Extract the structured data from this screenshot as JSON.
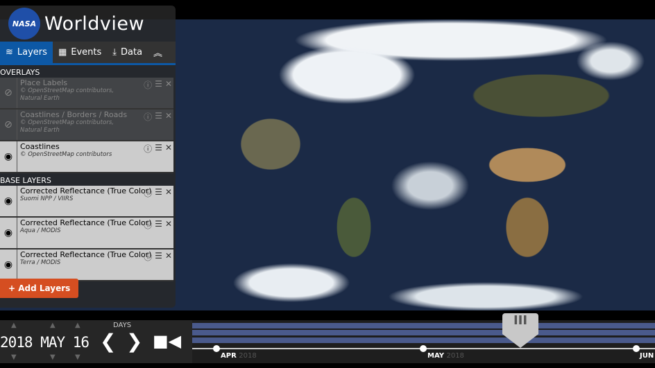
{
  "app": {
    "title": "Worldview",
    "logo": "NASA"
  },
  "tabs": [
    {
      "label": "Layers",
      "icon": "layers-icon"
    },
    {
      "label": "Events",
      "icon": "calendar-icon"
    },
    {
      "label": "Data",
      "icon": "download-icon"
    }
  ],
  "overlays": {
    "title": "OVERLAYS",
    "items": [
      {
        "name": "Place Labels",
        "sub1": "© OpenStreetMap contributors,",
        "sub2": "Natural Earth",
        "visible": false
      },
      {
        "name": "Coastlines / Borders / Roads",
        "sub1": "© OpenStreetMap contributors,",
        "sub2": "Natural Earth",
        "visible": false
      },
      {
        "name": "Coastlines",
        "sub1": "© OpenStreetMap contributors",
        "sub2": "",
        "visible": true
      }
    ]
  },
  "base": {
    "title": "BASE LAYERS",
    "items": [
      {
        "name": "Corrected Reflectance (True Color)",
        "sub1": "Suomi NPP / VIIRS",
        "visible": true
      },
      {
        "name": "Corrected Reflectance (True Color)",
        "sub1": "Aqua / MODIS",
        "visible": true
      },
      {
        "name": "Corrected Reflectance (True Color)",
        "sub1": "Terra / MODIS",
        "visible": true
      }
    ]
  },
  "add_layers": "+ Add Layers",
  "timeline": {
    "date": "2018 MAY 16",
    "unit": "DAYS",
    "months": [
      {
        "m": "APR",
        "y": "2018"
      },
      {
        "m": "MAY",
        "y": "2018"
      },
      {
        "m": "JUN",
        "y": ""
      }
    ],
    "handle": "III"
  }
}
